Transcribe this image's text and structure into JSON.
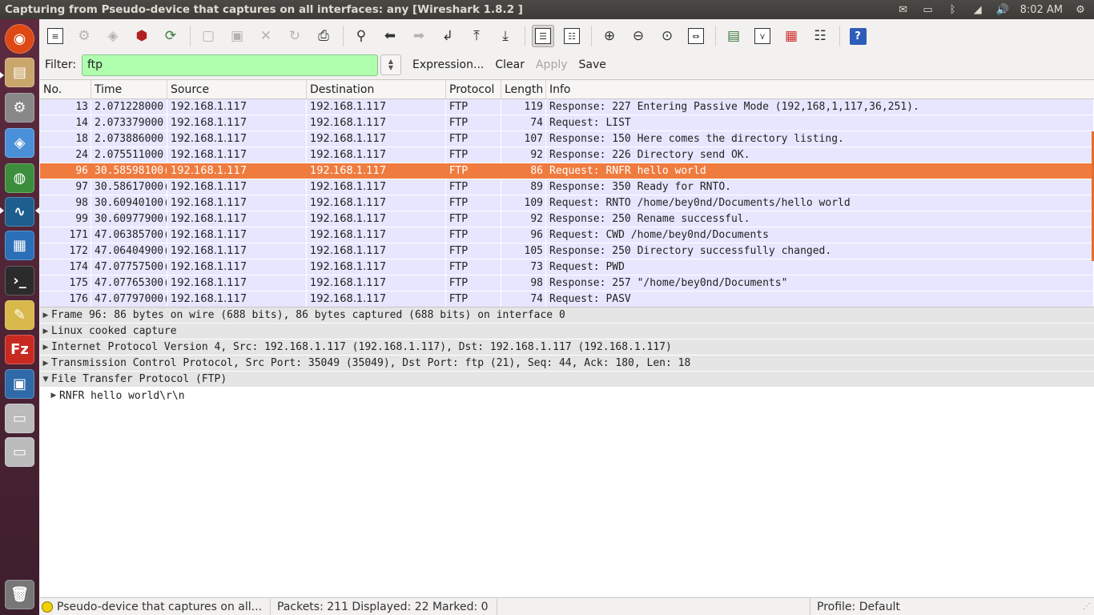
{
  "window": {
    "title": "Capturing from Pseudo-device that captures on all interfaces: any    [Wireshark 1.8.2 ]"
  },
  "tray": {
    "clock": "8:02 AM",
    "icons": [
      "mail-icon",
      "battery-icon",
      "bluetooth-icon",
      "network-icon",
      "volume-icon",
      "gear-icon"
    ]
  },
  "launcher": {
    "items": [
      "dash-home",
      "files",
      "settings-manager",
      "3d-box",
      "chrome",
      "wireshark",
      "libreoffice",
      "terminal",
      "text-editor",
      "filezilla",
      "workspace-switcher",
      "drive",
      "drive",
      "trash"
    ]
  },
  "toolbar": {
    "buttons": [
      "interfaces",
      "options",
      "start",
      "stop",
      "restart",
      "open",
      "save",
      "close",
      "reload",
      "print",
      "find",
      "back",
      "forward",
      "goto",
      "first",
      "last",
      "colorize",
      "autoscroll",
      "zoom-in",
      "zoom-out",
      "normal-size",
      "resize-columns",
      "capture-filters",
      "display-filters",
      "coloring-rules",
      "preferences",
      "help"
    ]
  },
  "filter": {
    "label": "Filter:",
    "value": "ftp",
    "expression": "Expression...",
    "clear": "Clear",
    "apply": "Apply",
    "save": "Save",
    "input_color": "#afffaf"
  },
  "packet_list": {
    "headers": [
      "No.",
      "Time",
      "Source",
      "Destination",
      "Protocol",
      "Length",
      "Info"
    ],
    "selected_color": "#f07b3f",
    "row_color": "#e7e6ff",
    "rows": [
      {
        "no": "13",
        "time": "2.071228000",
        "src": "192.168.1.117",
        "dst": "192.168.1.117",
        "proto": "FTP",
        "len": "119",
        "info": "Response: 227 Entering Passive Mode (192,168,1,117,36,251)."
      },
      {
        "no": "14",
        "time": "2.073379000",
        "src": "192.168.1.117",
        "dst": "192.168.1.117",
        "proto": "FTP",
        "len": "74",
        "info": "Request: LIST"
      },
      {
        "no": "18",
        "time": "2.073886000",
        "src": "192.168.1.117",
        "dst": "192.168.1.117",
        "proto": "FTP",
        "len": "107",
        "info": "Response: 150 Here comes the directory listing."
      },
      {
        "no": "24",
        "time": "2.075511000",
        "src": "192.168.1.117",
        "dst": "192.168.1.117",
        "proto": "FTP",
        "len": "92",
        "info": "Response: 226 Directory send OK."
      },
      {
        "no": "96",
        "time": "30.58598100(",
        "src": "192.168.1.117",
        "dst": "192.168.1.117",
        "proto": "FTP",
        "len": "86",
        "info": "Request: RNFR hello world",
        "selected": true
      },
      {
        "no": "97",
        "time": "30.58617000(",
        "src": "192.168.1.117",
        "dst": "192.168.1.117",
        "proto": "FTP",
        "len": "89",
        "info": "Response: 350 Ready for RNTO."
      },
      {
        "no": "98",
        "time": "30.60940100(",
        "src": "192.168.1.117",
        "dst": "192.168.1.117",
        "proto": "FTP",
        "len": "109",
        "info": "Request: RNTO /home/bey0nd/Documents/hello world"
      },
      {
        "no": "99",
        "time": "30.60977900(",
        "src": "192.168.1.117",
        "dst": "192.168.1.117",
        "proto": "FTP",
        "len": "92",
        "info": "Response: 250 Rename successful."
      },
      {
        "no": "171",
        "time": "47.06385700(",
        "src": "192.168.1.117",
        "dst": "192.168.1.117",
        "proto": "FTP",
        "len": "96",
        "info": "Request: CWD /home/bey0nd/Documents"
      },
      {
        "no": "172",
        "time": "47.06404900(",
        "src": "192.168.1.117",
        "dst": "192.168.1.117",
        "proto": "FTP",
        "len": "105",
        "info": "Response: 250 Directory successfully changed."
      },
      {
        "no": "174",
        "time": "47.07757500(",
        "src": "192.168.1.117",
        "dst": "192.168.1.117",
        "proto": "FTP",
        "len": "73",
        "info": "Request: PWD"
      },
      {
        "no": "175",
        "time": "47.07765300(",
        "src": "192.168.1.117",
        "dst": "192.168.1.117",
        "proto": "FTP",
        "len": "98",
        "info": "Response: 257 \"/home/bey0nd/Documents\""
      },
      {
        "no": "176",
        "time": "47.07797000(",
        "src": "192.168.1.117",
        "dst": "192.168.1.117",
        "proto": "FTP",
        "len": "74",
        "info": "Request: PASV"
      }
    ]
  },
  "details": {
    "rows": [
      {
        "text": "Frame 96: 86 bytes on wire (688 bits), 86 bytes captured (688 bits) on interface 0",
        "expanded": false
      },
      {
        "text": "Linux cooked capture",
        "expanded": false
      },
      {
        "text": "Internet Protocol Version 4, Src: 192.168.1.117 (192.168.1.117), Dst: 192.168.1.117 (192.168.1.117)",
        "expanded": false
      },
      {
        "text": "Transmission Control Protocol, Src Port: 35049 (35049), Dst Port: ftp (21), Seq: 44, Ack: 180, Len: 18",
        "expanded": false
      },
      {
        "text": "File Transfer Protocol (FTP)",
        "expanded": true
      }
    ],
    "subrow": "RNFR hello world\\r\\n"
  },
  "status": {
    "interface": "Pseudo-device that captures on all...",
    "packets": "Packets: 211 Displayed: 22 Marked: 0",
    "profile": "Profile: Default"
  }
}
